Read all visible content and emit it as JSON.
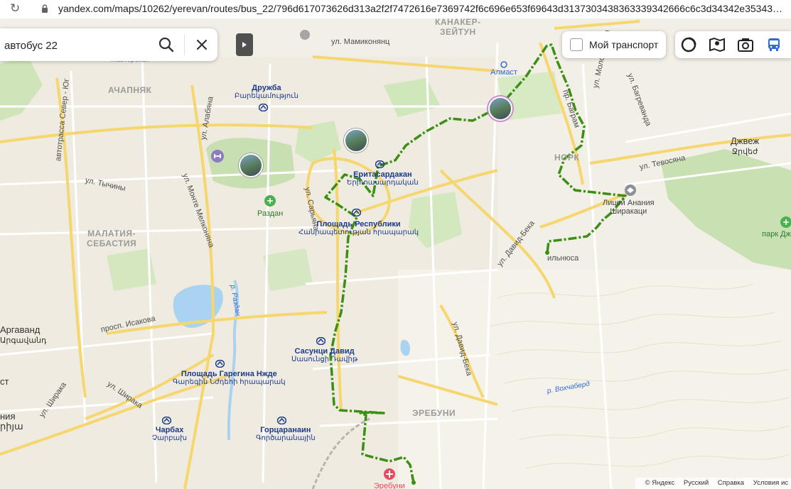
{
  "browser": {
    "url": "yandex.com/maps/10262/yerevan/routes/bus_22/796d617073626d313a2f2f7472616e7369742f6c696e653f69643d3137303438363339342666c6c3d34342e353435..."
  },
  "search": {
    "value": "автобус 22",
    "placeholder": ""
  },
  "controls": {
    "my_transport_label": "Мой транспорт"
  },
  "route": {
    "name": "bus 22",
    "color": "#3b8f12"
  },
  "map_labels": {
    "kanaker_zeytun": "КАНАКЕР-\nЗЕЙТУН",
    "ul_mamikonyants": "ул. Мамиконянц",
    "masterskaya": "Мастерская",
    "almast": "Алмаст",
    "achapnyak": "АЧАПНЯК",
    "druzhba_ru": "Дружба",
    "druzhba_hy": "Բարեկամություն",
    "ul_alabyana": "ул. Алабяна",
    "avtotrassa": "автотрасса Север - Юг",
    "ul_tychiny": "ул. Тычины",
    "ul_monte": "ул. Монте Мелконяна",
    "razdan": "Раздан",
    "malatia": "МАЛАТИЯ-\nСЕБАСТИЯ",
    "yeritasardakan_ru": "Еритасардакан",
    "yeritasardakan_hy": "Երիտասարդական",
    "ploshchad_resp_ru": "Площадь Республики",
    "ploshchad_resp_hy": "Հանրապետության հրապարակ",
    "ul_saryana": "ул. Сарьяна",
    "nork": "НОРК",
    "ul_tevosyana": "ул. Тевосяна",
    "dzhvezh_ru": "Джвеж",
    "dzhvezh_hy": "Ջրվեժ",
    "litsey": "Лицей Анания\nШиракаци",
    "park": "парк Дж",
    "ul_david_beka": "ул. Давид-Бека",
    "ilnyusa": "ильнюса",
    "pr_bagr": "пр. Баграм",
    "ul_molod": "ул. Молодёжная",
    "ul_bagrevanda": "ул. Багреванда",
    "pr_isakova": "просп. Исакова",
    "argavand_ru": "Аргаванд",
    "argavand_hy": "Արգավանդ",
    "sasuntsi_ru": "Сасунци Давид",
    "sasuntsi_hy": "Սասունցի Դավիթ",
    "ul_davida_beka2": "ул. Давид-Бека",
    "garegin_ru": "Площадь Гарегина Нжде",
    "garegin_hy": "Գարեգին Նժդեհի հրապարակ",
    "ul_shiraka1": "ул. Ширака",
    "ul_shiraka2": "ул. Ширака",
    "charbakh_ru": "Чарбах",
    "charbakh_hy": "Չարբախ",
    "gortsaranain_ru": "Горцаранаин",
    "gortsaranain_hy": "Գործարանային",
    "erebuni": "ЭРЕБУНИ",
    "erebuni_hosp": "Эребуни",
    "vokhchaberd": "р. Вохчаберд",
    "left_st": "ст",
    "left_nya": "ния\nրիյա",
    "razdan_river": "р. Раздан"
  },
  "footer": {
    "copyright": "© Яндекс",
    "lang": "Русский",
    "help": "Справка",
    "terms": "Условия ис"
  }
}
